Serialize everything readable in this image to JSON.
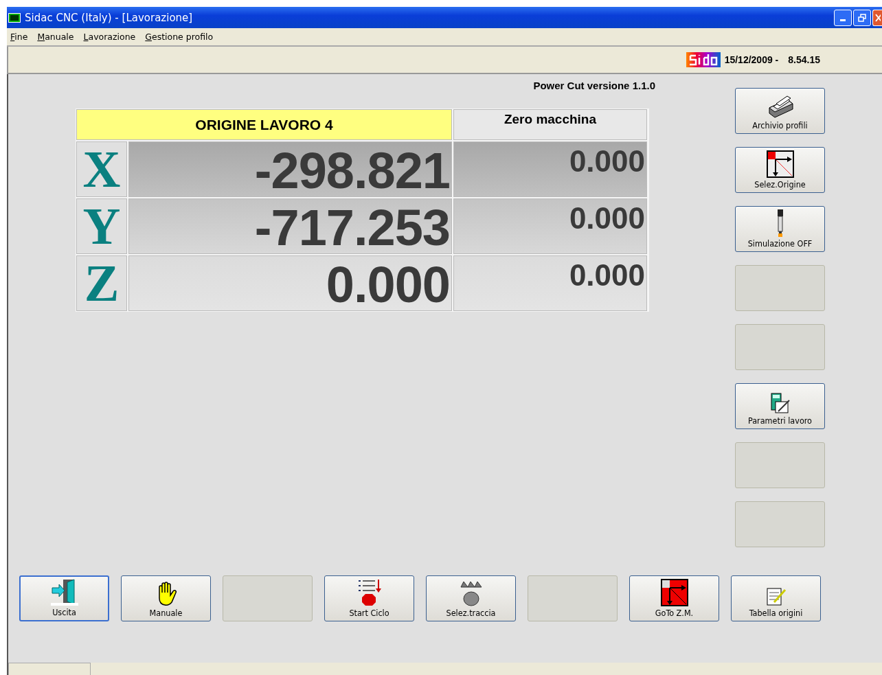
{
  "window": {
    "title": "Sidac CNC (Italy) - [Lavorazione]"
  },
  "menu": [
    {
      "label": "Fine"
    },
    {
      "label": "Manuale"
    },
    {
      "label": "Lavorazione"
    },
    {
      "label": "Gestione profilo"
    }
  ],
  "header": {
    "date": "15/12/2009 -",
    "time": "8.54.15"
  },
  "version": "Power Cut versione 1.1.0",
  "table": {
    "origin_title": "ORIGINE LAVORO  4",
    "machine_title": "Zero macchina",
    "rows": [
      {
        "axis": "X",
        "value": "-298.821",
        "machine": "0.000"
      },
      {
        "axis": "Y",
        "value": "-717.253",
        "machine": "0.000"
      },
      {
        "axis": "Z",
        "value": "0.000",
        "machine": "0.000"
      }
    ]
  },
  "side_buttons": [
    {
      "kind": "action",
      "label": "Archivio profili"
    },
    {
      "kind": "action",
      "label": "Selez.Origine"
    },
    {
      "kind": "action",
      "label": "Simulazione OFF"
    },
    {
      "kind": "blank"
    },
    {
      "kind": "blank"
    },
    {
      "kind": "action",
      "label": "Parametri lavoro"
    },
    {
      "kind": "blank"
    },
    {
      "kind": "blank"
    }
  ],
  "bottom_buttons": [
    {
      "kind": "action",
      "label": "Uscita",
      "focused": true
    },
    {
      "kind": "action",
      "label": "Manuale",
      "focused": false
    },
    {
      "kind": "blank"
    },
    {
      "kind": "action",
      "label": "Start Ciclo",
      "focused": false
    },
    {
      "kind": "action",
      "label": "Selez.traccia",
      "focused": false
    },
    {
      "kind": "blank"
    },
    {
      "kind": "action",
      "label": "GoTo Z.M.",
      "focused": false
    },
    {
      "kind": "action",
      "label": "Tabella origini",
      "focused": false
    }
  ]
}
